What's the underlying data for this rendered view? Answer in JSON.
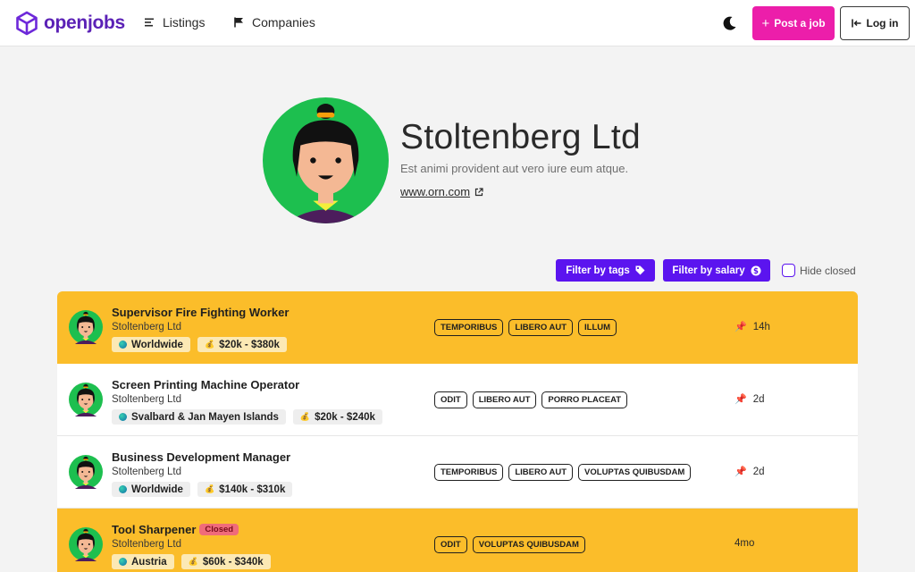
{
  "brand": {
    "name": "openjobs",
    "color": "#5b21b6"
  },
  "nav": {
    "listings": "Listings",
    "companies": "Companies",
    "post_job": "Post a job",
    "log_in": "Log in"
  },
  "company": {
    "name": "Stoltenberg Ltd",
    "description": "Est animi provident aut vero iure eum atque.",
    "website": "www.orn.com"
  },
  "filters": {
    "tags": "Filter by tags",
    "salary": "Filter by salary",
    "hide_closed": "Hide closed"
  },
  "colors": {
    "accent_purple": "#5b14ef",
    "post_pink": "#ec1eaa",
    "highlight_yellow": "#fbbd2a",
    "closed_red": "#f06b7a"
  },
  "jobs": [
    {
      "title": "Supervisor Fire Fighting Worker",
      "company": "Stoltenberg Ltd",
      "location": "Worldwide",
      "salary": "$20k - $380k",
      "tags": [
        "TEMPORIBUS",
        "LIBERO AUT",
        "ILLUM"
      ],
      "age": "14h",
      "pinned": true,
      "closed": false,
      "highlighted": true
    },
    {
      "title": "Screen Printing Machine Operator",
      "company": "Stoltenberg Ltd",
      "location": "Svalbard & Jan Mayen Islands",
      "salary": "$20k - $240k",
      "tags": [
        "ODIT",
        "LIBERO AUT",
        "PORRO PLACEAT"
      ],
      "age": "2d",
      "pinned": true,
      "closed": false,
      "highlighted": false
    },
    {
      "title": "Business Development Manager",
      "company": "Stoltenberg Ltd",
      "location": "Worldwide",
      "salary": "$140k - $310k",
      "tags": [
        "TEMPORIBUS",
        "LIBERO AUT",
        "VOLUPTAS QUIBUSDAM"
      ],
      "age": "2d",
      "pinned": true,
      "closed": false,
      "highlighted": false
    },
    {
      "title": "Tool Sharpener",
      "closed_label": "Closed",
      "company": "Stoltenberg Ltd",
      "location": "Austria",
      "salary": "$60k - $340k",
      "tags": [
        "ODIT",
        "VOLUPTAS QUIBUSDAM"
      ],
      "age": "4mo",
      "pinned": false,
      "closed": true,
      "highlighted": true
    }
  ]
}
